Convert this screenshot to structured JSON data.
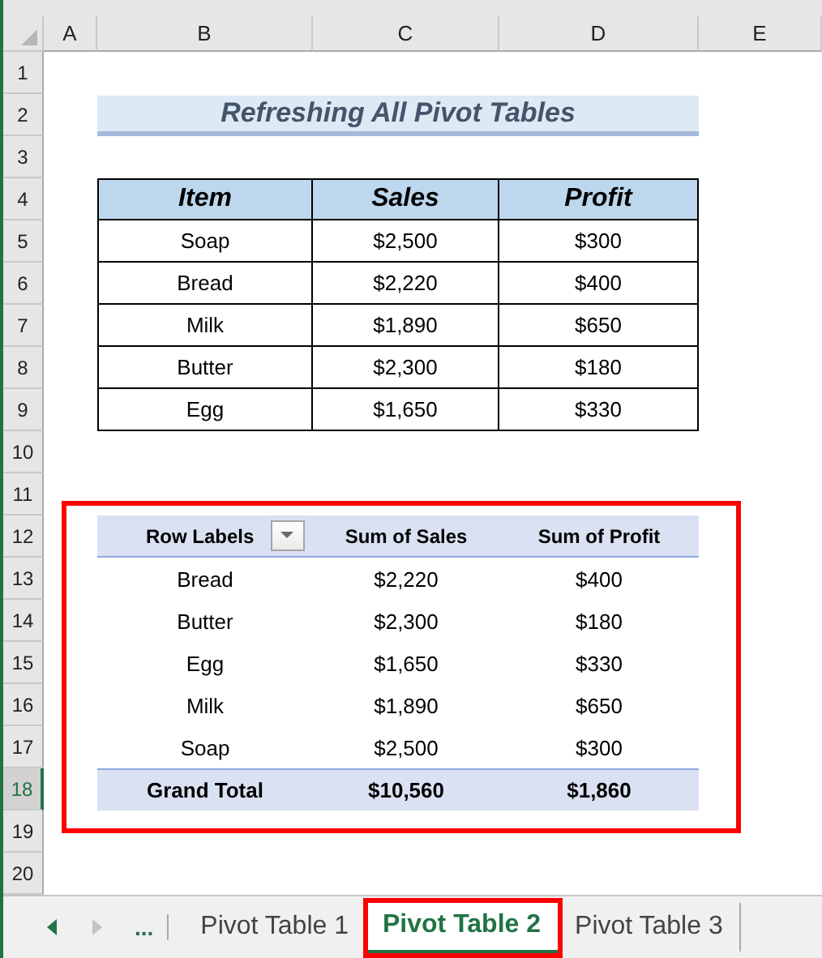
{
  "columns": [
    {
      "label": "A",
      "selected": false
    },
    {
      "label": "B",
      "selected": false
    },
    {
      "label": "C",
      "selected": false
    },
    {
      "label": "D",
      "selected": false
    },
    {
      "label": "E",
      "selected": false
    }
  ],
  "rows": [
    {
      "label": "1",
      "selected": false
    },
    {
      "label": "2",
      "selected": false
    },
    {
      "label": "3",
      "selected": false
    },
    {
      "label": "4",
      "selected": false
    },
    {
      "label": "5",
      "selected": false
    },
    {
      "label": "6",
      "selected": false
    },
    {
      "label": "7",
      "selected": false
    },
    {
      "label": "8",
      "selected": false
    },
    {
      "label": "9",
      "selected": false
    },
    {
      "label": "10",
      "selected": false
    },
    {
      "label": "11",
      "selected": false
    },
    {
      "label": "12",
      "selected": false
    },
    {
      "label": "13",
      "selected": false
    },
    {
      "label": "14",
      "selected": false
    },
    {
      "label": "15",
      "selected": false
    },
    {
      "label": "16",
      "selected": false
    },
    {
      "label": "17",
      "selected": false
    },
    {
      "label": "18",
      "selected": true
    },
    {
      "label": "19",
      "selected": false
    },
    {
      "label": "20",
      "selected": false
    }
  ],
  "title": "Refreshing All Pivot Tables",
  "table": {
    "columns": [
      "Item",
      "Sales",
      "Profit"
    ],
    "rows": [
      [
        "Soap",
        "$2,500",
        "$300"
      ],
      [
        "Bread",
        "$2,220",
        "$400"
      ],
      [
        "Milk",
        "$1,890",
        "$650"
      ],
      [
        "Butter",
        "$2,300",
        "$180"
      ],
      [
        "Egg",
        "$1,650",
        "$330"
      ]
    ]
  },
  "pivot": {
    "highlighted": true,
    "columns": [
      "Row Labels",
      "Sum of Sales",
      "Sum of Profit"
    ],
    "rows": [
      [
        "Bread",
        "$2,220",
        "$400"
      ],
      [
        "Butter",
        "$2,300",
        "$180"
      ],
      [
        "Egg",
        "$1,650",
        "$330"
      ],
      [
        "Milk",
        "$1,890",
        "$650"
      ],
      [
        "Soap",
        "$2,500",
        "$300"
      ]
    ],
    "total": [
      "Grand Total",
      "$10,560",
      "$1,860"
    ]
  },
  "sheet_tabs": {
    "overflow": "...",
    "tabs": [
      {
        "label": "Pivot Table 1",
        "selected": false,
        "highlighted": false
      },
      {
        "label": "Pivot Table 2",
        "selected": true,
        "highlighted": true
      },
      {
        "label": "Pivot Table 3",
        "selected": false,
        "highlighted": false
      }
    ]
  }
}
